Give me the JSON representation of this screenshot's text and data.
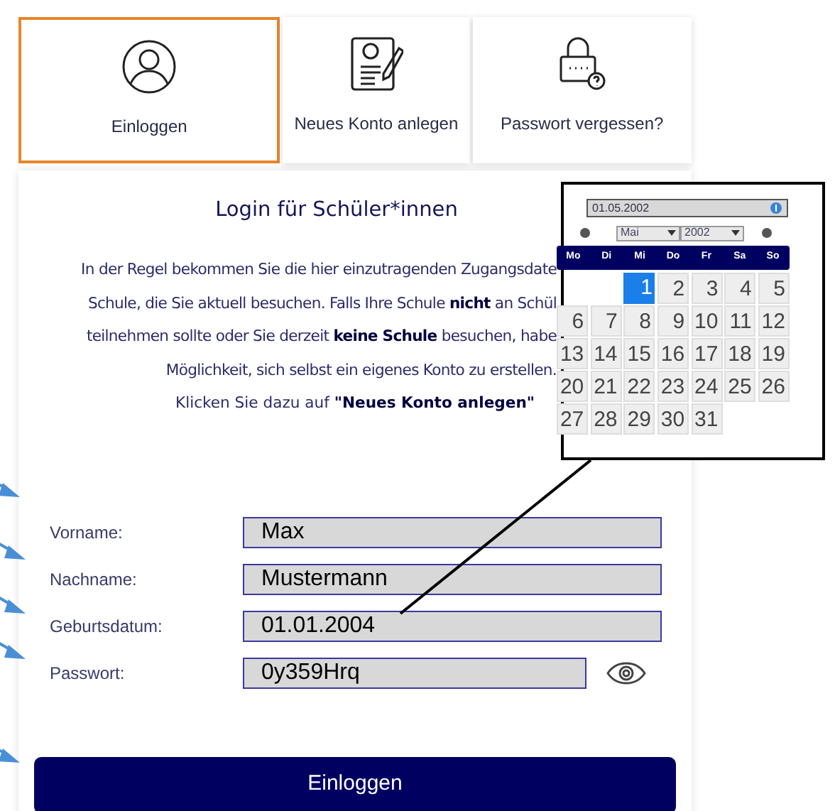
{
  "tabs": [
    {
      "label": "Einloggen",
      "selected": true,
      "kind": "user"
    },
    {
      "label": "Neues Konto anlegen",
      "selected": false,
      "kind": "form"
    },
    {
      "label": "Passwort vergessen?",
      "selected": false,
      "kind": "lock"
    }
  ],
  "login": {
    "title": "Login für Schüler*innen",
    "paragraph_lines": [
      "In der Regel bekommen Sie die hier einzutragenden Zugangsdate",
      "Schule, die Sie aktuell besuchen. Falls Ihre Schule **nicht** an Schül",
      "teilnehmen sollte oder Sie derzeit **keine Schule** besuchen, habe",
      "Möglichkeit, sich selbst ein eigenes Konto zu erstellen.",
      "Klicken Sie dazu auf **\"Neues Konto anlegen\"**"
    ],
    "fields": [
      {
        "label": "Vorname:",
        "value": "Max",
        "kind": "text"
      },
      {
        "label": "Nachname:",
        "value": "Mustermann",
        "kind": "text"
      },
      {
        "label": "Geburtsdatum:",
        "value": "01.01.2004",
        "kind": "date"
      },
      {
        "label": "Passwort:",
        "value": "0y359Hrq",
        "kind": "password"
      }
    ],
    "button": "Einloggen"
  },
  "callout": {
    "date_input": "01.05.2002",
    "month": "Mai",
    "year": "2002",
    "weekdays": [
      "Mo",
      "Di",
      "Mi",
      "Do",
      "Fr",
      "Sa",
      "So"
    ],
    "weeks": [
      [
        {
          "kind": "blank"
        },
        {
          "kind": "blank"
        },
        {
          "day": "1",
          "selected": true
        },
        {
          "day": "2",
          "selected": false
        },
        {
          "day": "3",
          "selected": false
        },
        {
          "day": "4",
          "selected": false
        },
        {
          "day": "5",
          "selected": false
        }
      ],
      [
        {
          "day": "6",
          "selected": false
        },
        {
          "day": "7",
          "selected": false
        },
        {
          "day": "8",
          "selected": false
        },
        {
          "day": "9",
          "selected": false
        },
        {
          "day": "10",
          "selected": false
        },
        {
          "day": "11",
          "selected": false
        },
        {
          "day": "12",
          "selected": false
        }
      ],
      [
        {
          "day": "13",
          "selected": false
        },
        {
          "day": "14",
          "selected": false
        },
        {
          "day": "15",
          "selected": false
        },
        {
          "day": "16",
          "selected": false
        },
        {
          "day": "17",
          "selected": false
        },
        {
          "day": "18",
          "selected": false
        },
        {
          "day": "19",
          "selected": false
        }
      ],
      [
        {
          "day": "20",
          "selected": false
        },
        {
          "day": "21",
          "selected": false
        },
        {
          "day": "22",
          "selected": false
        },
        {
          "day": "23",
          "selected": false
        },
        {
          "day": "24",
          "selected": false
        },
        {
          "day": "25",
          "selected": false
        },
        {
          "day": "26",
          "selected": false
        }
      ],
      [
        {
          "day": "27",
          "selected": false
        },
        {
          "day": "28",
          "selected": false
        },
        {
          "day": "29",
          "selected": false
        },
        {
          "day": "30",
          "selected": false
        },
        {
          "day": "31",
          "selected": false
        },
        {
          "kind": "blank"
        },
        {
          "kind": "blank"
        }
      ]
    ]
  }
}
